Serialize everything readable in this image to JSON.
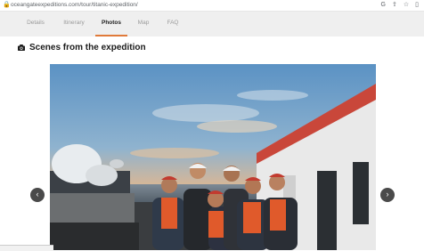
{
  "browser": {
    "url": "oceangateexpeditions.com/tour/titanic-expedition/",
    "icons": [
      "google-icon",
      "share-icon",
      "star-icon",
      "extensions-icon"
    ]
  },
  "nav": {
    "tabs": [
      {
        "label": "Details",
        "active": false
      },
      {
        "label": "Itinerary",
        "active": false
      },
      {
        "label": "Photos",
        "active": true
      },
      {
        "label": "Map",
        "active": false
      },
      {
        "label": "FAQ",
        "active": false
      }
    ],
    "active_color": "#e07a3a"
  },
  "section": {
    "title": "Scenes from the expedition",
    "icon": "camera-icon"
  },
  "gallery": {
    "prev_label": "‹",
    "next_label": "›",
    "photo_alt": "Expedition crew on ship deck at sunset"
  }
}
